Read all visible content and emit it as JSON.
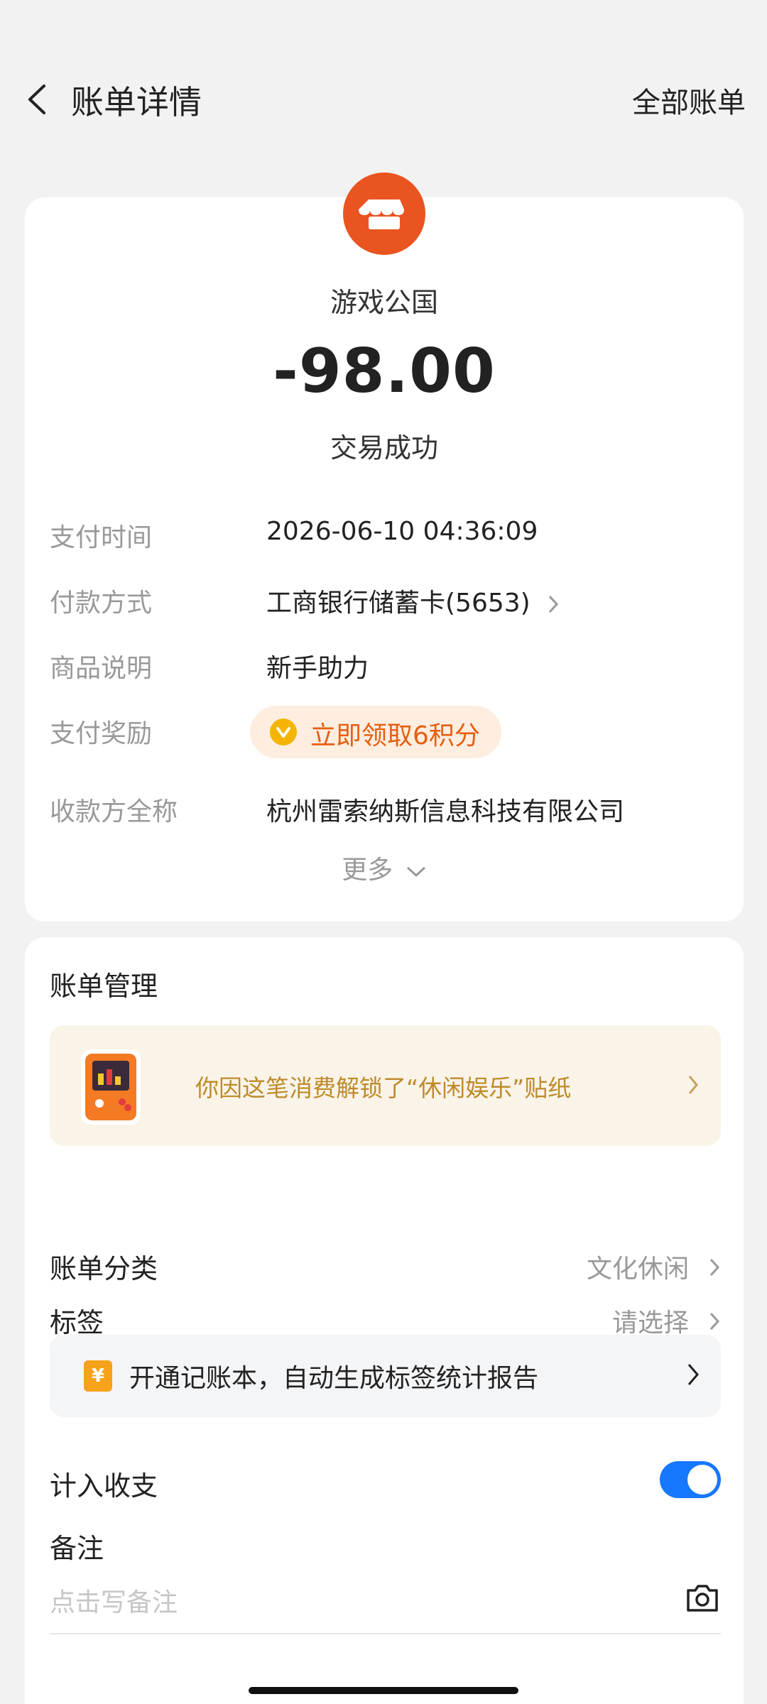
{
  "header": {
    "title": "账单详情",
    "right_link": "全部账单"
  },
  "summary": {
    "merchant_icon": "storefront-icon",
    "merchant_name": "游戏公国",
    "amount": "-98.00",
    "status": "交易成功"
  },
  "details": {
    "rows": [
      {
        "label": "支付时间",
        "value": "2026-06-10 04:36:09"
      },
      {
        "label": "付款方式",
        "value": "工商银行储蓄卡(5653)"
      },
      {
        "label": "商品说明",
        "value": "新手助力"
      },
      {
        "label": "支付奖励",
        "value": "立即领取6积分"
      },
      {
        "label": "收款方全称",
        "value": "杭州雷索纳斯信息科技有限公司"
      }
    ],
    "more": "更多"
  },
  "management": {
    "title": "账单管理",
    "sticker_banner": "你因这笔消费解锁了“休闲娱乐”贴纸",
    "category_label": "账单分类",
    "category_value": "文化休闲",
    "tag_label": "标签",
    "tag_value": "请选择",
    "ledger_banner": "开通记账本，自动生成标签统计报告",
    "include_label": "计入收支",
    "include_enabled": true,
    "note_label": "备注",
    "note_placeholder": "点击写备注"
  },
  "colors": {
    "accent_orange": "#ea5420",
    "reward_text": "#e55f12",
    "toggle_blue": "#1677ff"
  }
}
